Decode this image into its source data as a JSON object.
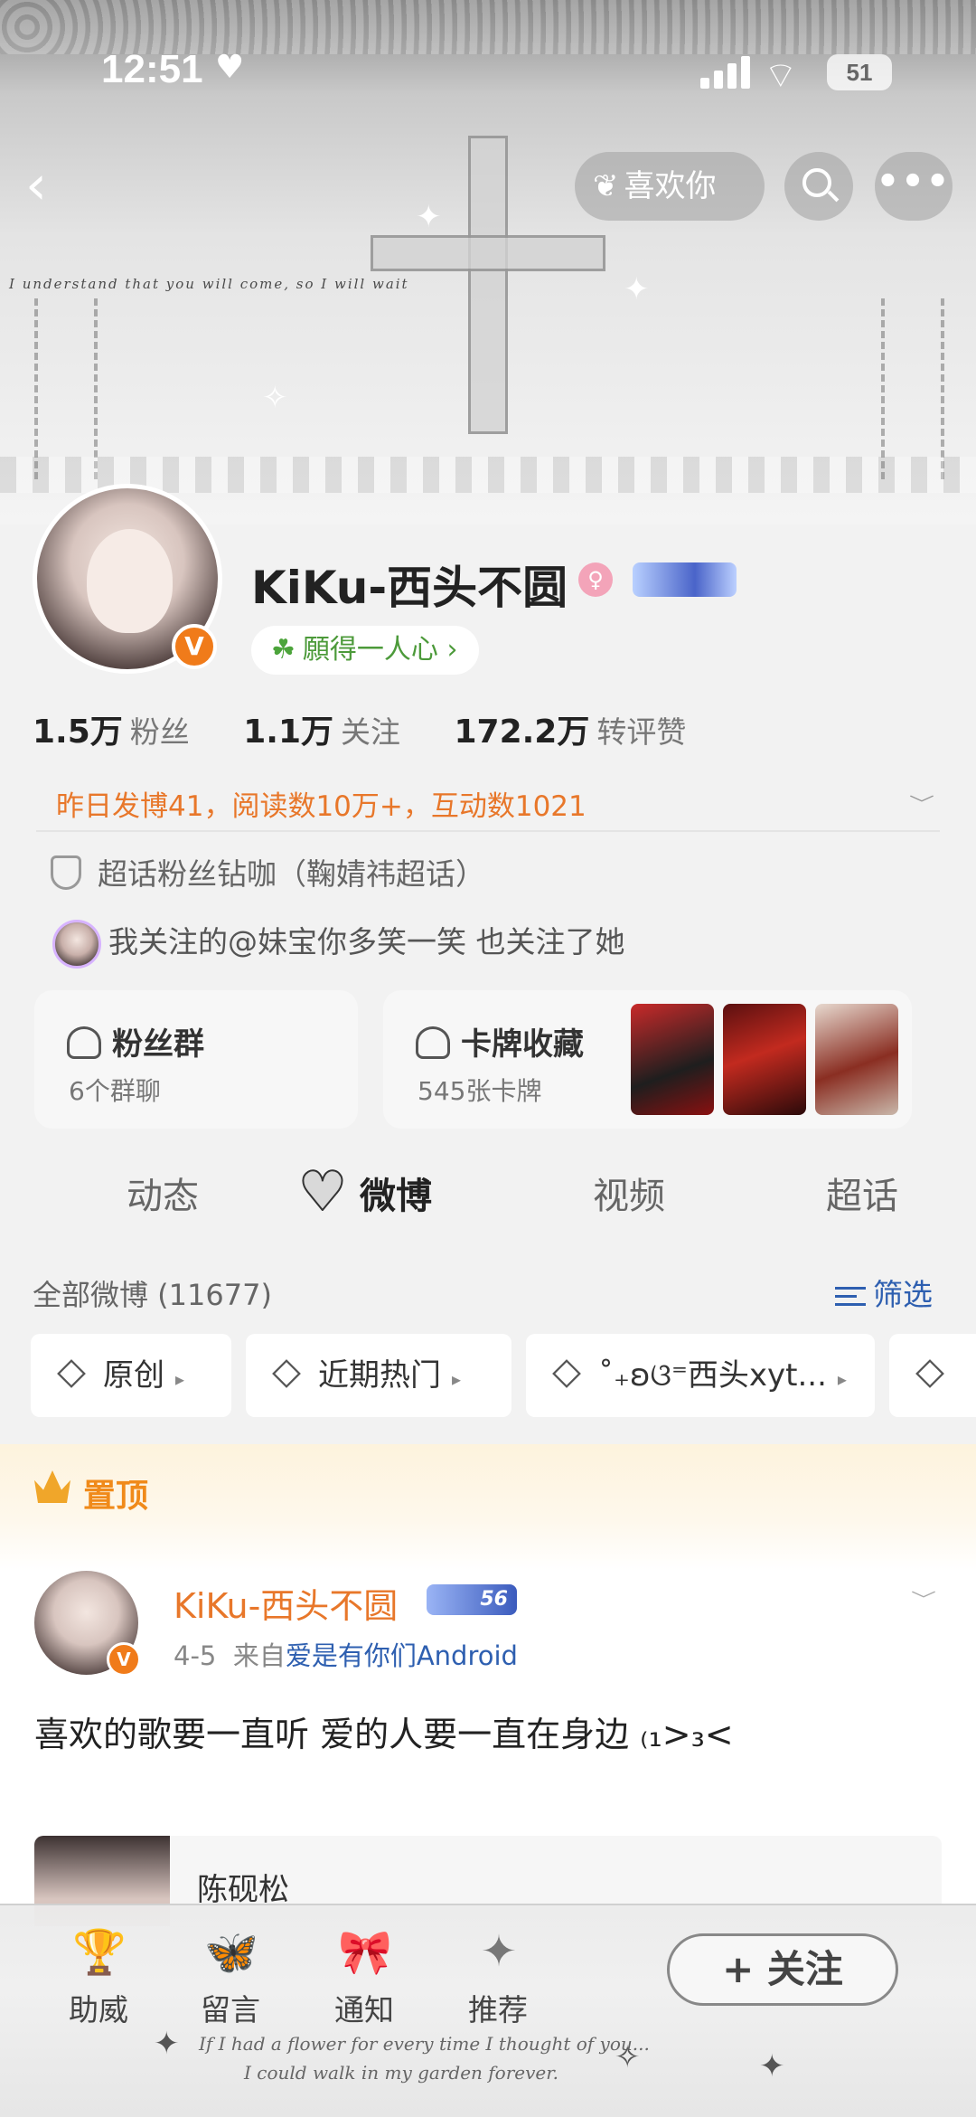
{
  "status_bar": {
    "time": "12:51",
    "battery": "51"
  },
  "nav": {
    "like_label": "喜欢你"
  },
  "banner": {
    "whisper_text": "I understand that you will come, so I will wait"
  },
  "profile": {
    "username": "KiKu-西头不圆",
    "motto": "願得一人心",
    "stats": [
      {
        "value": "1.5万",
        "label": "粉丝"
      },
      {
        "value": "1.1万",
        "label": "关注"
      },
      {
        "value": "172.2万",
        "label": "转评赞"
      }
    ],
    "activity": "昨日发博41，阅读数10万+，互动数1021",
    "chaohua": "超话粉丝钻咖（鞠婧祎超话）",
    "follow_note": "我关注的@妹宝你多笑一笑 也关注了她"
  },
  "cards": {
    "fans_title": "粉丝群",
    "fans_sub": "6个群聊",
    "collect_title": "卡牌收藏",
    "collect_sub": "545张卡牌"
  },
  "tabs": [
    "动态",
    "微博",
    "视频",
    "超话"
  ],
  "feed": {
    "all_count": "全部微博 (11677)",
    "filter_label": "筛选",
    "chips": [
      "原创",
      "近期热门",
      "˚₊ʚଓ⁼西头xyt..."
    ],
    "pinned_label": "置顶"
  },
  "post": {
    "user": "KiKu-西头不圆",
    "level": "56",
    "date": "4-5",
    "from_prefix": "来自",
    "source": "爱是有你们Android",
    "text": "喜欢的歌要一直听 爱的人要一直在身边 ₍₁>₃<",
    "repost_name": "陈砚松"
  },
  "bottom_bar": {
    "items": [
      "助威",
      "留言",
      "通知",
      "推荐"
    ],
    "follow_label": "+ 关注",
    "script_line1": "If I had a flower for every time I thought of you...",
    "script_line2": "I could walk in my garden forever."
  },
  "colors": {
    "accent_orange": "#e8772a",
    "link_blue": "#2e5fb0",
    "verified_orange": "#f07b1a"
  }
}
